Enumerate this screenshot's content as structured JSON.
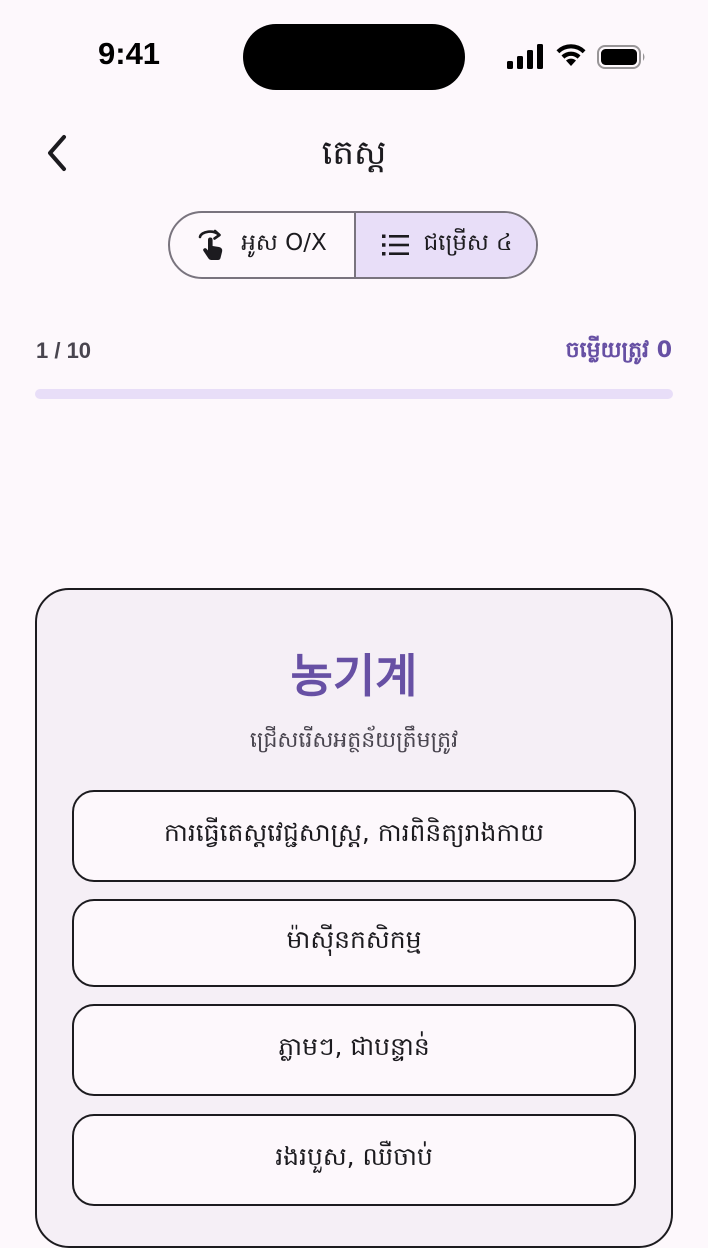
{
  "status_bar": {
    "time": "9:41"
  },
  "header": {
    "title": "តេស្ត"
  },
  "mode_toggle": {
    "swipe_label": "អូស O/X",
    "choice_label": "ជម្រើស ៤",
    "selected": "choice"
  },
  "progress": {
    "count": "1 / 10",
    "correct_label": "ចម្លើយត្រូវ 0",
    "fraction": 0.0
  },
  "question": {
    "word": "농기계",
    "instruction": "ជ្រើសរើសអត្ថន័យត្រឹមត្រូវ",
    "options": [
      "ការធ្វើតេស្តវេជ្ជសាស្ត្រ, ការពិនិត្យរាងកាយ",
      "ម៉ាស៊ីនកសិកម្ម",
      "ភ្លាមៗ, ជាបន្ទាន់",
      "រងរបួស, ឈឺចាប់"
    ]
  },
  "colors": {
    "accent": "#6750a4",
    "accent_container": "#e8def8",
    "background": "#fdf8fc",
    "card": "#f5eff6"
  },
  "icons": {
    "back": "chevron-left-icon",
    "swipe": "swipe-gesture-icon",
    "choice": "list-icon"
  }
}
